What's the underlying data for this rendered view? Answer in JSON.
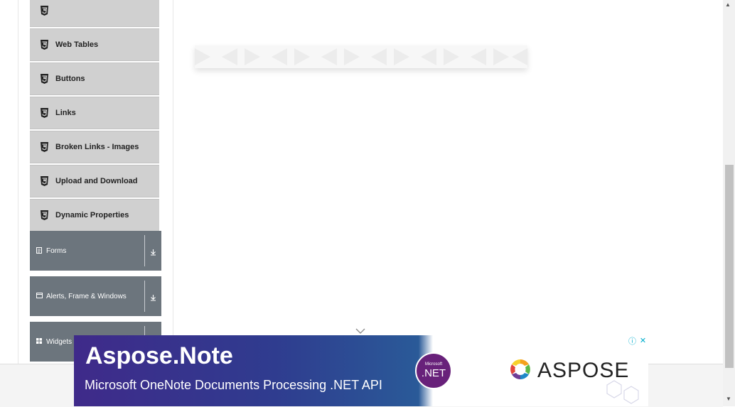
{
  "sidebar": {
    "items": [
      {
        "label": ""
      },
      {
        "label": "Web Tables"
      },
      {
        "label": "Buttons"
      },
      {
        "label": "Links"
      },
      {
        "label": "Broken Links - Images"
      },
      {
        "label": "Upload and Download"
      },
      {
        "label": "Dynamic Properties"
      }
    ],
    "groups": [
      {
        "label": "Forms",
        "icon": "form-icon"
      },
      {
        "label": "Alerts, Frame & Windows",
        "icon": "window-icon"
      },
      {
        "label": "Widgets",
        "icon": "widgets-icon"
      }
    ]
  },
  "ad": {
    "title": "Aspose.Note",
    "subtitle": "Microsoft OneNote Documents Processing .NET API",
    "badge_top": "Microsoft",
    "badge_main": ".NET",
    "brand": "ASPOSE",
    "info_glyph": "ⓘ",
    "close_glyph": "✕"
  },
  "colors": {
    "menu_item_bg": "#d0d0d0",
    "group_bg": "#6c757d",
    "ad_left": "#3f2a8a",
    "ad_right": "#2a5a98"
  }
}
